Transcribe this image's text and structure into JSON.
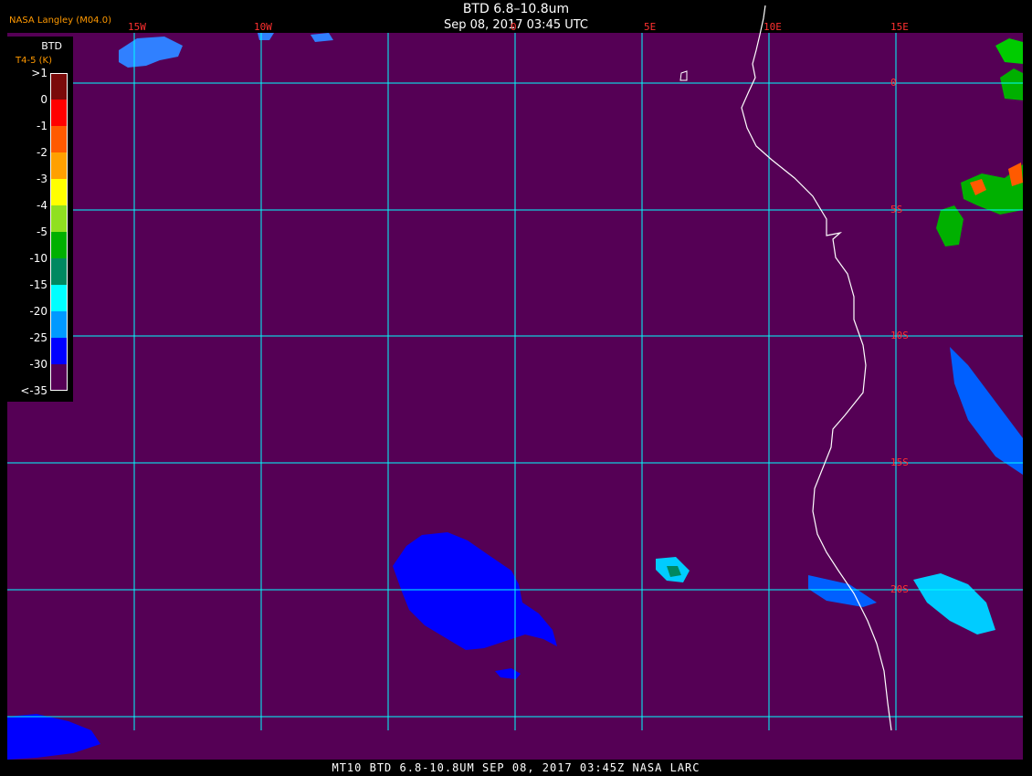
{
  "header": {
    "title": "BTD 6.8–10.8um",
    "timestamp": "Sep 08, 2017 03:45 UTC",
    "agency": "NASA Langley (M04.0)"
  },
  "footer": {
    "caption": "MT10  BTD 6.8-10.8UM   SEP 08, 2017 03:45Z   NASA LARC"
  },
  "legend": {
    "title": "BTD",
    "units": "T4-5 (K)",
    "entries": [
      {
        "label": ">1",
        "color": "#7a0a0a"
      },
      {
        "label": "0",
        "color": "#ff0000"
      },
      {
        "label": "-1",
        "color": "#ff5a00"
      },
      {
        "label": "-2",
        "color": "#ffa000"
      },
      {
        "label": "-3",
        "color": "#ffff00"
      },
      {
        "label": "-4",
        "color": "#90e020"
      },
      {
        "label": "-5",
        "color": "#00b000"
      },
      {
        "label": "-10",
        "color": "#008860"
      },
      {
        "label": "-15",
        "color": "#00ffff"
      },
      {
        "label": "-20",
        "color": "#0099ff"
      },
      {
        "label": "-25",
        "color": "#0000ff"
      },
      {
        "label": "-30",
        "color": "#550055"
      },
      {
        "label": "<-35",
        "color": ""
      }
    ]
  },
  "grid": {
    "longitudes": [
      "15W",
      "10W",
      "0",
      "5E",
      "10E",
      "15E"
    ],
    "latitudes": [
      "0",
      "5S",
      "10S",
      "15S",
      "20S"
    ]
  },
  "colors": {
    "background": "#550055",
    "gridline": "#00ffff",
    "coastline": "#ffffff",
    "grid_label": "#ff3030",
    "low_cloud": "#0000ff"
  }
}
